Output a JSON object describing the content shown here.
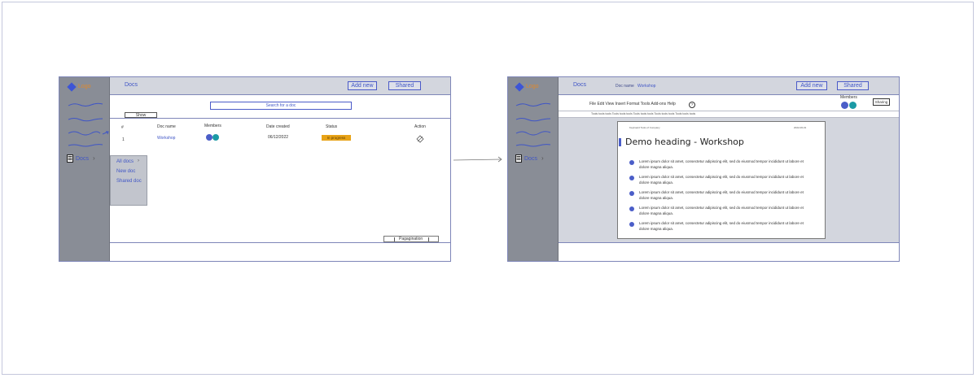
{
  "app": {
    "logo_text": "Logo"
  },
  "sidebar": {
    "docs_label": "Docs"
  },
  "left_screen": {
    "title": "Docs",
    "add_new": "Add new",
    "shared": "Shared",
    "search_placeholder": "Search for a doc",
    "show_label": "Show",
    "columns": [
      "#",
      "Doc name",
      "Members",
      "Date created",
      "Status",
      "Action"
    ],
    "row": {
      "index": "1",
      "doc_name": "Workshop",
      "date": "06/12/2022",
      "status": "In progress"
    },
    "menu": [
      "All docs",
      "New doc",
      "Shared doc"
    ],
    "pagination": "Pagagination"
  },
  "right_screen": {
    "title": "Docs",
    "doc_name_label": "Doc name",
    "doc_name": "Workshop",
    "add_new": "Add new",
    "shared": "Shared",
    "menu_items": [
      "File",
      "Edit",
      "View",
      "Insert",
      "Format",
      "Tools",
      "Add-ons",
      "Help"
    ],
    "help_icon": "?",
    "members_label": "Members",
    "sharing_button": "Sharing",
    "toolbar_text": "Tools  tools tools Tools tools tools Tools tools tools Tools tools tools Tools tools tools",
    "doc_header_left": "Keyboard Tools of Company",
    "doc_header_right": "2022-06-01",
    "doc_heading": "Demo heading - Workshop",
    "paragraphs": [
      "Lorem ipsum dolor sit amet, consectetur adipiscing elit, sed do eiusmod tempor incididunt ut labore et dolore magna aliqua.",
      "Lorem ipsum dolor sit amet, consectetur adipiscing elit, sed do eiusmod tempor incididunt ut labore et dolore magna aliqua.",
      "Lorem ipsum dolor sit amet, consectetur adipiscing elit, sed do eiusmod tempor incididunt ut labore et dolore magna aliqua.",
      "Lorem ipsum dolor sit amet, consectetur adipiscing elit, sed do eiusmod tempor incididunt ut labore et dolore magna aliqua.",
      "Lorem ipsum dolor sit amet, consectetur adipiscing elit, sed do eiusmod tempor incididunt ut labore et dolore magna aliqua."
    ]
  },
  "colors": {
    "accent": "#3f55c6",
    "sidebar": "#898d96",
    "topbar": "#d3d6de",
    "status": "#e8a317",
    "member_1": "#4b5ec8",
    "member_2": "#1b9aa5"
  }
}
